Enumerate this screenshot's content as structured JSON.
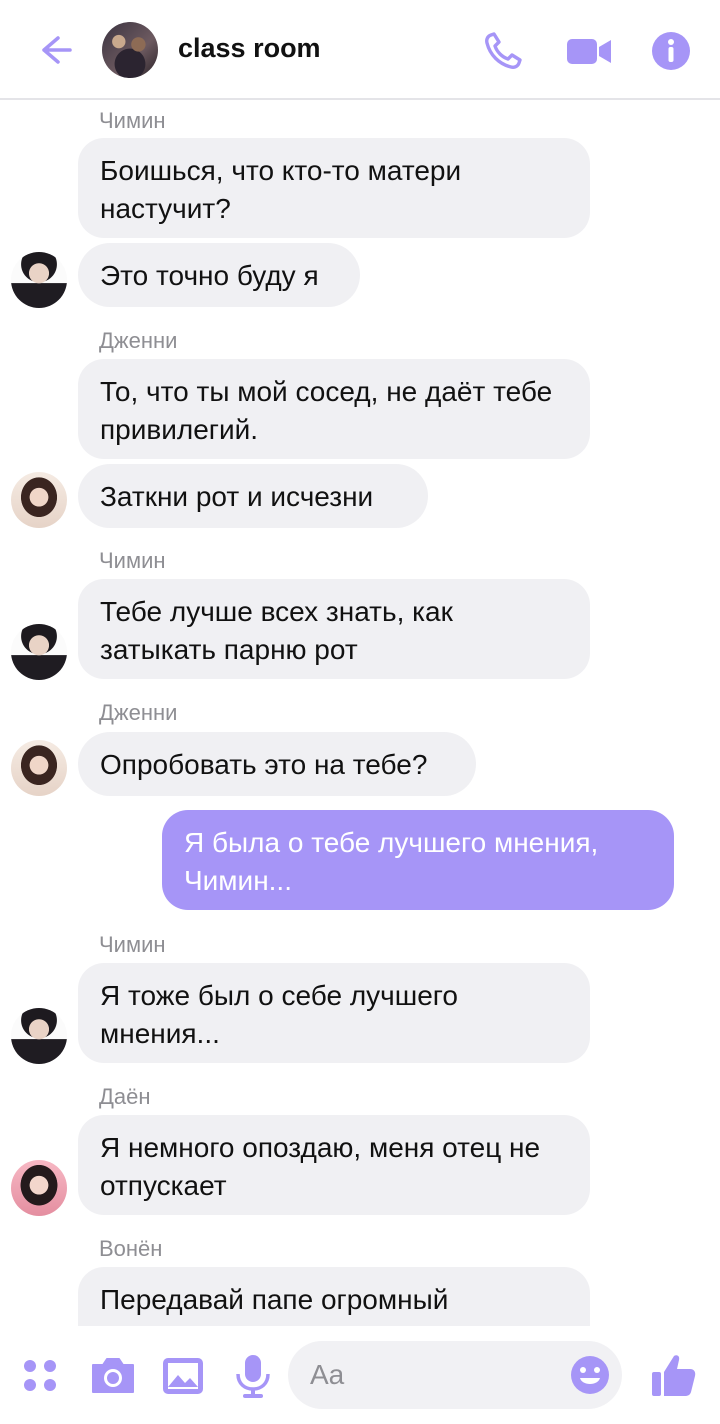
{
  "header": {
    "title": "class room",
    "icons": [
      "back-arrow-icon",
      "phone-icon",
      "video-camera-icon",
      "info-icon"
    ],
    "accent": "#a695f7"
  },
  "messages": [
    {
      "sender": "Чимин",
      "text": "Боишься, что кто-то матери настучит?",
      "direction": "incoming"
    },
    {
      "text": "Это точно буду я",
      "direction": "incoming"
    },
    {
      "sender": "Дженни",
      "text": "То, что ты мой сосед, не даёт тебе привилегий.",
      "direction": "incoming"
    },
    {
      "text": "Заткни рот и исчезни",
      "direction": "incoming"
    },
    {
      "sender": "Чимин",
      "text": "Тебе лучше всех знать, как затыкать парню рот",
      "direction": "incoming"
    },
    {
      "sender": "Дженни",
      "text": "Опробовать это на тебе?",
      "direction": "incoming"
    },
    {
      "text": "Я была о тебе лучшего мнения, Чимин...",
      "direction": "outgoing"
    },
    {
      "sender": "Чимин",
      "text": "Я тоже был о себе лучшего мнения...",
      "direction": "incoming"
    },
    {
      "sender": "Даён",
      "text": "Я немного опоздаю, меня отец не отпускает",
      "direction": "incoming"
    },
    {
      "sender": "Вонён",
      "text": "Передавай папе огромный",
      "direction": "incoming"
    }
  ],
  "composer": {
    "placeholder": "Aa",
    "icons": [
      "apps-grid-icon",
      "camera-icon",
      "image-icon",
      "microphone-icon",
      "emoji-icon",
      "thumbs-up-icon"
    ]
  },
  "colors": {
    "incoming_bubble": "#f0f0f3",
    "outgoing_bubble": "#a695f7",
    "icon_purple": "#a695f7"
  }
}
